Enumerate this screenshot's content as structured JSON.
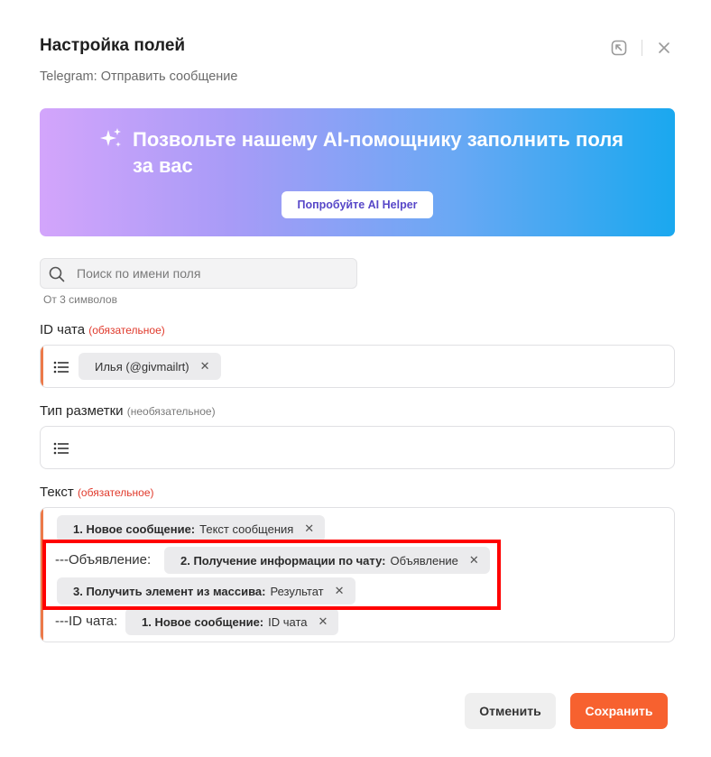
{
  "header": {
    "title": "Настройка полей",
    "subtitle": "Telegram: Отправить сообщение"
  },
  "banner": {
    "text": "Позвольте нашему AI-помощнику заполнить поля за вас",
    "button_label": "Попробуйте AI Helper"
  },
  "search": {
    "placeholder": "Поиск по имени поля",
    "value": "",
    "hint": "От 3 символов"
  },
  "fields": {
    "chat_id": {
      "label": "ID чата",
      "requirement": "(обязательное)",
      "chip": {
        "label": "Илья (@givmailrt)"
      }
    },
    "markup_type": {
      "label": "Тип разметки",
      "requirement": "(необязательное)"
    },
    "text": {
      "label": "Текст",
      "requirement": "(обязательное)",
      "chip1": {
        "bold": "1. Новое сообщение:",
        "value": "Текст сообщения"
      },
      "line2_prefix": "---Объявление:",
      "chip2": {
        "bold": "2. Получение информации по чату:",
        "value": "Объявление"
      },
      "chip3": {
        "bold": "3. Получить элемент из массива:",
        "value": "Результат"
      },
      "line4_prefix": "---ID чата:",
      "chip4": {
        "bold": "1. Новое сообщение:",
        "value": "ID чата"
      }
    }
  },
  "footer": {
    "cancel_label": "Отменить",
    "save_label": "Сохранить"
  },
  "colors": {
    "accent": "#f7612f",
    "required": "#e0392b",
    "highlight": "#ff0000"
  }
}
